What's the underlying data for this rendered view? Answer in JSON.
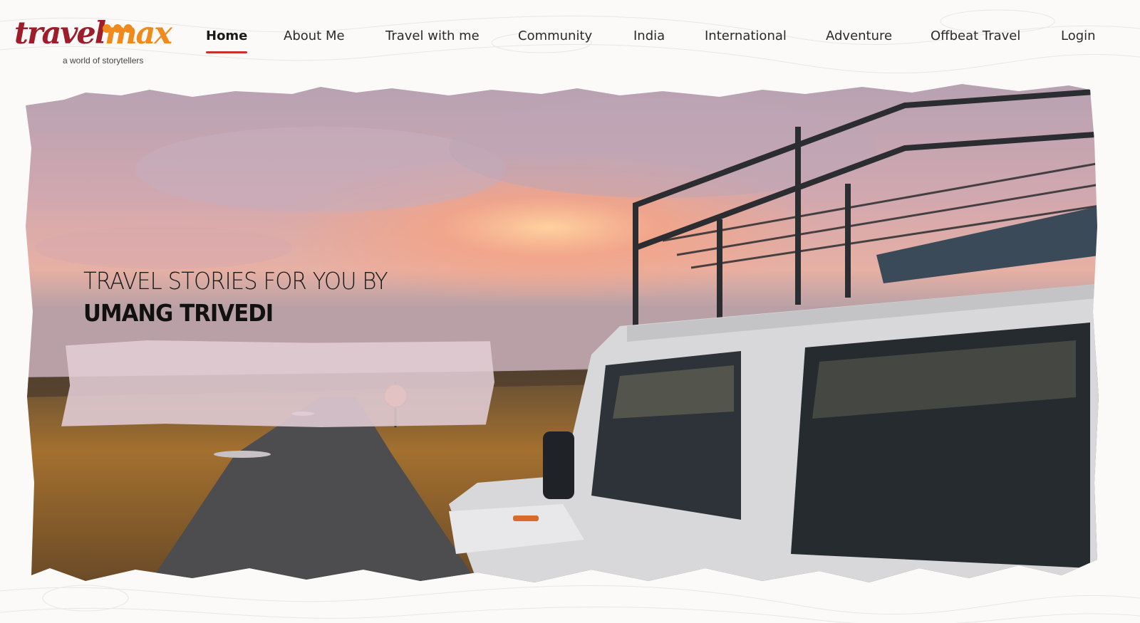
{
  "brand": {
    "word_part1": "travel",
    "word_part2": "max",
    "tagline": "a world of storytellers",
    "primary_color": "#9e1d2a",
    "accent_color": "#f08a1c"
  },
  "nav": {
    "items": [
      {
        "label": "Home",
        "active": true
      },
      {
        "label": "About Me"
      },
      {
        "label": "Travel with me"
      },
      {
        "label": "Community"
      },
      {
        "label": "India"
      },
      {
        "label": "International"
      },
      {
        "label": "Adventure"
      },
      {
        "label": "Offbeat Travel"
      },
      {
        "label": "Login"
      }
    ],
    "active_underline_color": "#c9302c"
  },
  "hero": {
    "headline_line1": "TRAVEL STORIES FOR YOU BY",
    "headline_line2": "UMANG TRIVEDI",
    "image_description_icon": "landrover-sunset-photo"
  }
}
